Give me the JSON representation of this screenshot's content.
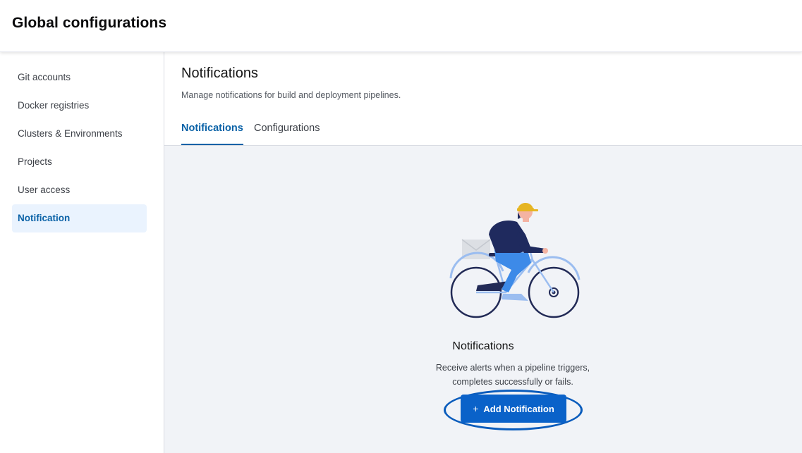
{
  "header": {
    "title": "Global configurations"
  },
  "sidebar": {
    "items": [
      {
        "label": "Git accounts",
        "active": false
      },
      {
        "label": "Docker registries",
        "active": false
      },
      {
        "label": "Clusters & Environments",
        "active": false
      },
      {
        "label": "Projects",
        "active": false
      },
      {
        "label": "User access",
        "active": false
      },
      {
        "label": "Notification",
        "active": true
      }
    ]
  },
  "main": {
    "title": "Notifications",
    "description": "Manage notifications for build and deployment pipelines.",
    "tabs": [
      {
        "label": "Notifications",
        "active": true
      },
      {
        "label": "Configurations",
        "active": false
      }
    ],
    "empty_state": {
      "illustration": "cyclist-with-envelope",
      "title": "Notifications",
      "description_line1": "Receive alerts when a pipeline triggers,",
      "description_line2": "completes successfully or fails.",
      "button_icon": "+",
      "button_label": "Add Notification"
    }
  },
  "colors": {
    "accent": "#0a62a7",
    "button": "#0a62c9",
    "content_bg": "#f1f3f7",
    "active_item_bg": "#eaf3fe"
  }
}
